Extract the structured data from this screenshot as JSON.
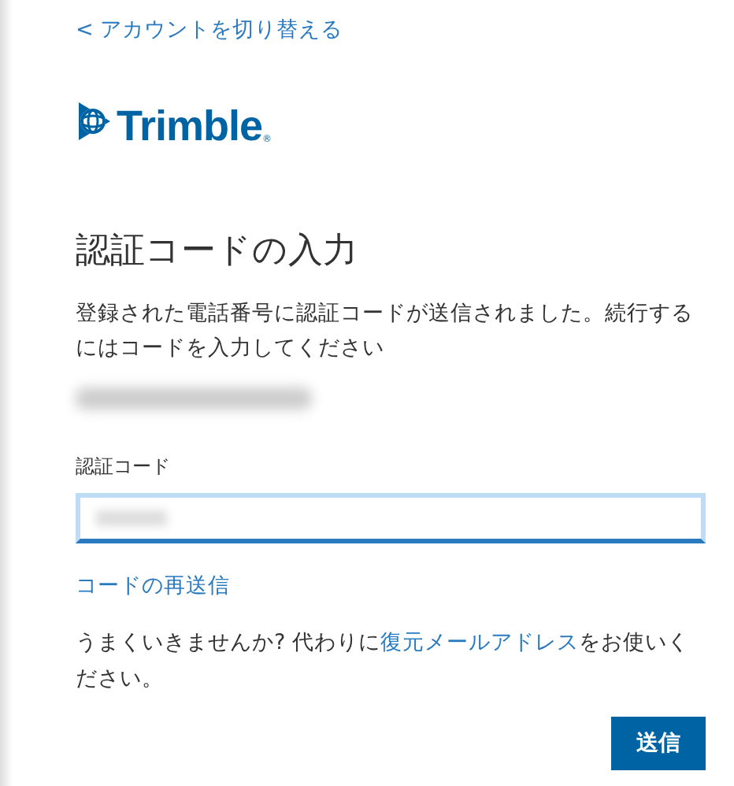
{
  "back_link": "< アカウントを切り替える",
  "logo": {
    "name": "Trimble",
    "mark": "®"
  },
  "title": "認証コードの入力",
  "message": "登録された電話番号に認証コードが送信されました。続行するにはコードを入力してください",
  "code_field": {
    "label": "認証コード",
    "focused": true
  },
  "resend_link": "コードの再送信",
  "help": {
    "before": "うまくいきませんか? 代わりに",
    "link": "復元メールアドレス",
    "after": "をお使いください。"
  },
  "buttons": [
    "送信"
  ]
}
